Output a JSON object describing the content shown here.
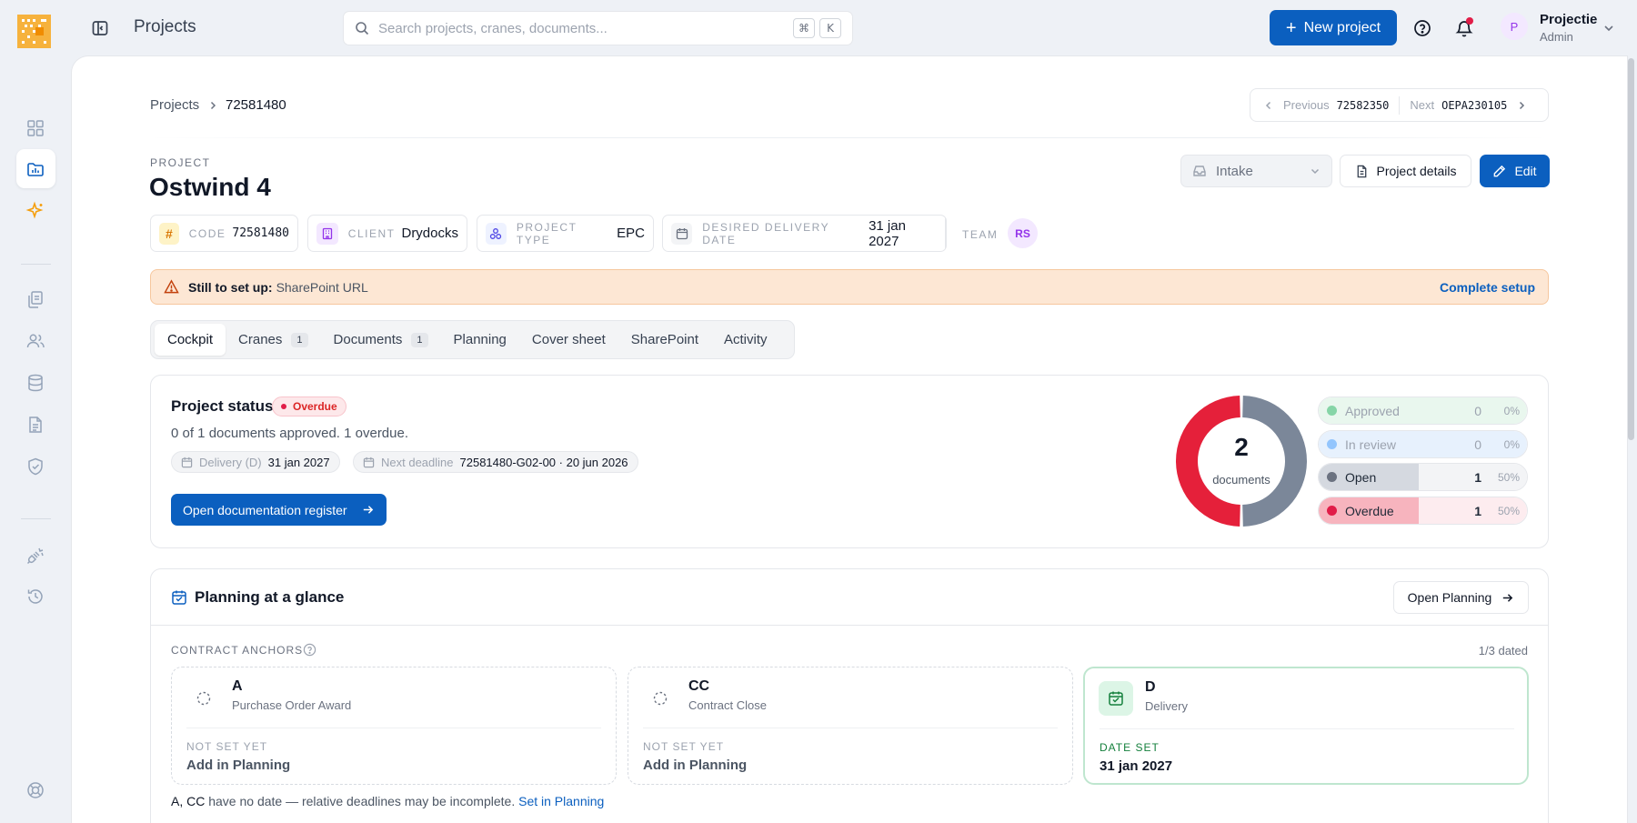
{
  "header": {
    "page_title": "Projects",
    "search_placeholder": "Search projects, cranes, documents...",
    "shortcut_keys": [
      "⌘",
      "K"
    ],
    "new_project_label": "New project",
    "user": {
      "initial": "P",
      "name": "Projectie",
      "role": "Admin"
    }
  },
  "breadcrumb": {
    "root": "Projects",
    "current": "72581480"
  },
  "pager": {
    "previous_label": "Previous",
    "previous_code": "72582350",
    "next_label": "Next",
    "next_code": "OEPA230105"
  },
  "project": {
    "eyebrow": "PROJECT",
    "name": "Ostwind 4",
    "status_value": "Intake",
    "details_label": "Project details",
    "edit_label": "Edit",
    "meta": {
      "code_label": "CODE",
      "code_value": "72581480",
      "client_label": "CLIENT",
      "client_value": "Drydocks",
      "type_label": "PROJECT TYPE",
      "type_value": "EPC",
      "delivery_label": "DESIRED DELIVERY DATE",
      "delivery_value": "31 jan 2027",
      "team_label": "TEAM",
      "team_initials": "RS"
    }
  },
  "alert": {
    "bold": "Still to set up:",
    "text": "SharePoint URL",
    "action": "Complete setup"
  },
  "tabs": [
    {
      "label": "Cockpit",
      "badge": ""
    },
    {
      "label": "Cranes",
      "badge": "1"
    },
    {
      "label": "Documents",
      "badge": "1"
    },
    {
      "label": "Planning",
      "badge": ""
    },
    {
      "label": "Cover sheet",
      "badge": ""
    },
    {
      "label": "SharePoint",
      "badge": ""
    },
    {
      "label": "Activity",
      "badge": ""
    }
  ],
  "status": {
    "title": "Project status",
    "pill": "Overdue",
    "summary": "0 of 1 documents approved. 1 overdue.",
    "delivery_key": "Delivery (D)",
    "delivery_value": "31 jan 2027",
    "deadline_key": "Next deadline",
    "deadline_value": "72581480-G02-00 · 20 jun 2026",
    "register_button": "Open documentation register",
    "donut_total": "2",
    "donut_label": "documents",
    "legend": [
      {
        "name": "Approved",
        "count": "0",
        "pct": "0%",
        "color": "#86d5a7",
        "fill": "#e9f7ee"
      },
      {
        "name": "In review",
        "count": "0",
        "pct": "0%",
        "color": "#93c5fd",
        "fill": "#e7f1fd"
      },
      {
        "name": "Open",
        "count": "1",
        "pct": "50%",
        "color": "#6b7280",
        "fill": "#d5d9e0"
      },
      {
        "name": "Overdue",
        "count": "1",
        "pct": "50%",
        "color": "#e11d48",
        "fill": "#f7b4be"
      }
    ],
    "donut_segments": [
      {
        "name": "Open",
        "value": 1,
        "color": "#7b8799"
      },
      {
        "name": "Overdue",
        "value": 1,
        "color": "#e5203a"
      }
    ]
  },
  "planning": {
    "title": "Planning at a glance",
    "open_button": "Open Planning",
    "anchors_label": "CONTRACT ANCHORS",
    "anchors_count": "1/3 dated",
    "anchors": [
      {
        "code": "A",
        "name": "Purchase Order Award",
        "state": "NOT SET YET",
        "value": "Add in Planning",
        "set": false
      },
      {
        "code": "CC",
        "name": "Contract Close",
        "state": "NOT SET YET",
        "value": "Add in Planning",
        "set": false
      },
      {
        "code": "D",
        "name": "Delivery",
        "state": "DATE SET",
        "value": "31 jan 2027",
        "set": true
      }
    ],
    "note_codes": "A, CC",
    "note_text": "have no date — relative deadlines may be incomplete.",
    "note_link": "Set in Planning"
  }
}
